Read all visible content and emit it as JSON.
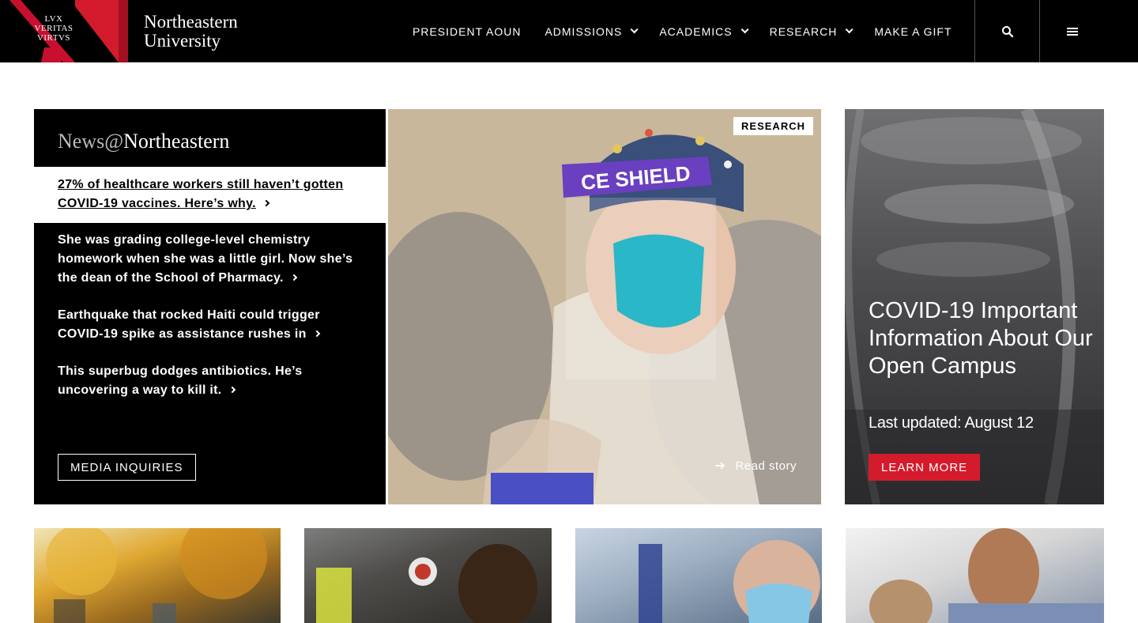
{
  "header": {
    "logo": {
      "motto": [
        "LVX",
        "VERITAS",
        "VIRTVS"
      ],
      "name_line1": "Northeastern",
      "name_line2": "University"
    },
    "nav": [
      {
        "label": "PRESIDENT AOUN",
        "dropdown": false
      },
      {
        "label": "ADMISSIONS",
        "dropdown": true
      },
      {
        "label": "ACADEMICS",
        "dropdown": true
      },
      {
        "label": "RESEARCH",
        "dropdown": true
      },
      {
        "label": "MAKE A GIFT",
        "dropdown": false
      }
    ],
    "search_icon": "search-icon",
    "menu_icon": "hamburger-menu-icon"
  },
  "news": {
    "heading_prefix": "News@",
    "heading_name": "Northeastern",
    "feature": "27% of healthcare workers still haven’t gotten COVID-19 vaccines. Here’s why.",
    "items": [
      "She was grading college-level chemistry homework when she was a little girl. Now she’s the dean of the School of Pharmacy.",
      "Earthquake that rocked Haiti could trigger COVID-19 spike as assistance rushes in",
      "This superbug dodges antibiotics. He’s uncovering a way to kill it."
    ],
    "media_button": "MEDIA INQUIRIES"
  },
  "hero": {
    "tag": "RESEARCH",
    "read_story": "Read story",
    "shield_text": "CE SHIELD"
  },
  "covid": {
    "title": "COVID-19 Important Information About Our Open Campus",
    "updated": "Last updated: August 12",
    "button": "LEARN MORE"
  },
  "colors": {
    "brand_red": "#d41b2c",
    "header_bg": "#000000"
  }
}
